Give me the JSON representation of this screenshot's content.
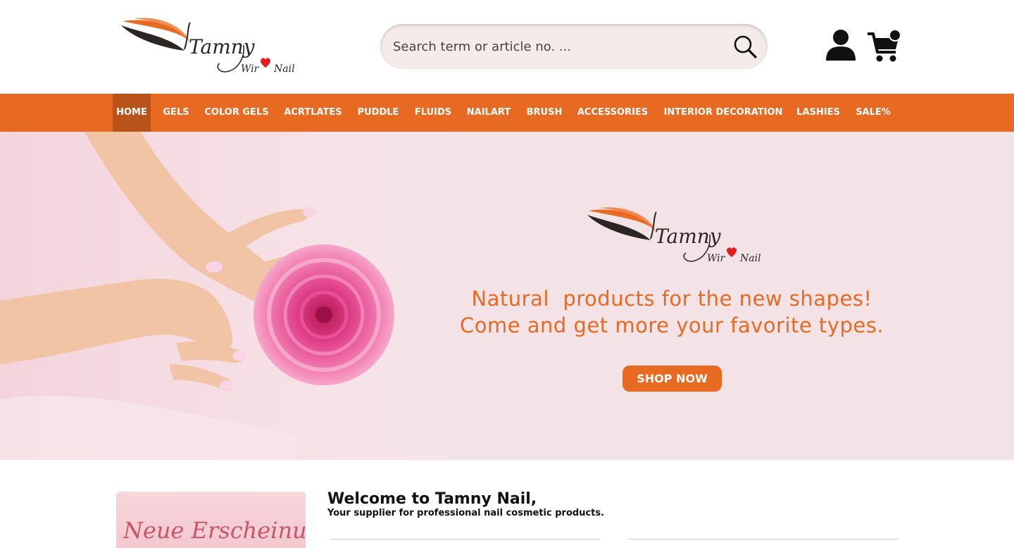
{
  "colors": {
    "brand_orange": "#e86a22",
    "brand_dark": "#2b2523",
    "active_nav": "#b9531b",
    "hero_bg": "#f3e3e7"
  },
  "header": {
    "logo": {
      "brand": "Tamny",
      "tagline_left": "Wir",
      "tagline_right": "Nail",
      "icon": "heart-icon"
    },
    "search": {
      "placeholder": "Search term or article no. ...",
      "value": "",
      "icon": "search-icon"
    },
    "account_icon": "user-icon",
    "cart_icon": "cart-icon"
  },
  "nav": {
    "items": [
      {
        "label": "HOME",
        "active": true
      },
      {
        "label": "GELS"
      },
      {
        "label": "COLOR GELS"
      },
      {
        "label": "ACRTLATES"
      },
      {
        "label": "PUDDLE"
      },
      {
        "label": "FLUIDS"
      },
      {
        "label": "NAILART"
      },
      {
        "label": "BRUSH"
      },
      {
        "label": "ACCESSORIES"
      },
      {
        "label": "INTERIOR DECORATION"
      },
      {
        "label": "LASHIES"
      },
      {
        "label": "SALE%"
      }
    ]
  },
  "hero": {
    "line1": "Natural  products for the new shapes!",
    "line2": "Come and get more your favorite types.",
    "cta": "SHOP NOW"
  },
  "promo": {
    "text": "Neue Erscheinung"
  },
  "welcome": {
    "title": "Welcome to Tamny Nail,",
    "subtitle": "Your supplier for professional nail cosmetic products."
  }
}
